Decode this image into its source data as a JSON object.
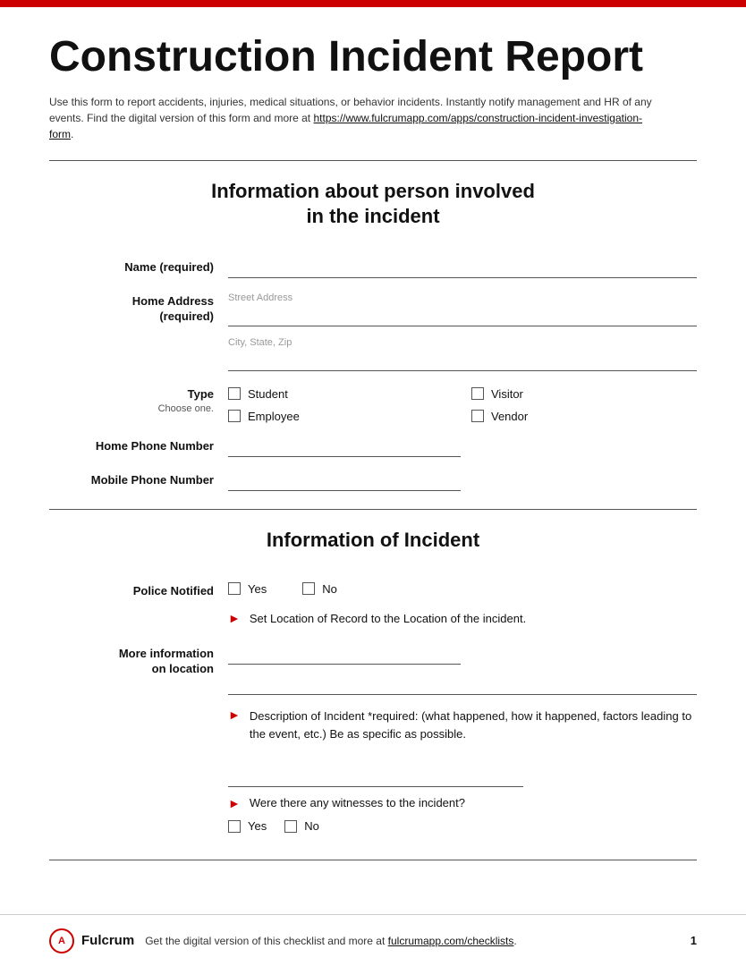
{
  "page": {
    "red_bar": true,
    "title": "Construction Incident Report",
    "description": "Use this form to report accidents, injuries, medical situations, or behavior incidents. Instantly notify management and HR of any events. Find the digital version of this form and more at",
    "url": "https://www.fulcrumapp.com/apps/construction-incident-investigation-form",
    "url_suffix": "."
  },
  "section1": {
    "title_line1": "Information about person involved",
    "title_line2": "in the incident"
  },
  "fields": {
    "name_label": "Name (required)",
    "home_address_label": "Home Address",
    "home_address_sub": "(required)",
    "street_placeholder": "Street Address",
    "city_placeholder": "City, State, Zip",
    "type_label": "Type",
    "type_sub": "Choose one.",
    "type_options": [
      {
        "label": "Student",
        "col": 1
      },
      {
        "label": "Visitor",
        "col": 2
      },
      {
        "label": "Employee",
        "col": 1
      },
      {
        "label": "Vendor",
        "col": 2
      }
    ],
    "home_phone_label": "Home Phone Number",
    "mobile_phone_label": "Mobile Phone Number"
  },
  "section2": {
    "title": "Information of Incident"
  },
  "incident_fields": {
    "police_notified_label": "Police Notified",
    "yes_label": "Yes",
    "no_label": "No",
    "location_instruction": "Set Location of Record to the Location of the incident.",
    "more_info_label": "More information",
    "more_info_sub": "on location",
    "description_label": "Description of Incident *required: (what happened, how it happened, factors leading to the event, etc.) Be as specific as possible.",
    "witnesses_label": "Were there any witnesses to the incident?",
    "witnesses_yes": "Yes",
    "witnesses_no": "No"
  },
  "footer": {
    "logo_text": "Fulcrum",
    "logo_letter": "A",
    "text": "Get the digital version of this checklist and more at",
    "link": "fulcrumapp.com/checklists",
    "link_suffix": ".",
    "page_number": "1"
  }
}
